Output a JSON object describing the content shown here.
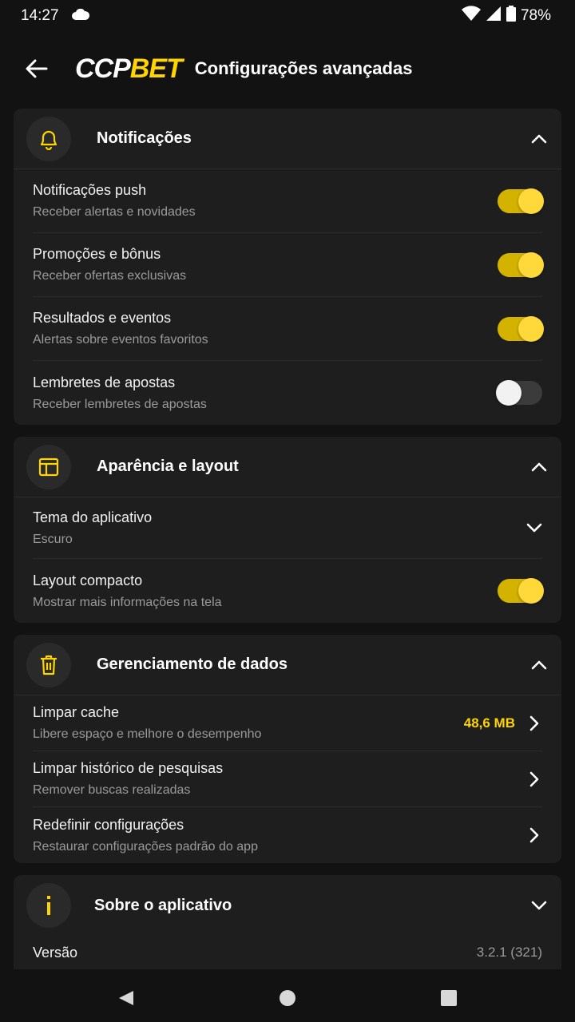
{
  "status_bar": {
    "time": "14:27",
    "battery": "78%",
    "icons": [
      "cloud-icon",
      "wifi-icon",
      "signal-icon",
      "battery-icon"
    ]
  },
  "header": {
    "back_icon": "arrow-left-icon",
    "logo_part1": "CCP",
    "logo_part2": "BET",
    "title": "Configurações avançadas"
  },
  "colors": {
    "accent": "#ffd400",
    "background": "#121212",
    "card": "#1e1e1e"
  },
  "notifications": {
    "title": "Notificações",
    "icon": "bell-icon",
    "items": [
      {
        "label": "Notificações push",
        "sub": "Receber alertas e novidades",
        "enabled": true
      },
      {
        "label": "Promoções e bônus",
        "sub": "Receber ofertas exclusivas",
        "enabled": true
      },
      {
        "label": "Resultados e eventos",
        "sub": "Alertas sobre eventos favoritos",
        "enabled": true
      },
      {
        "label": "Lembretes de apostas",
        "sub": "Receber lembretes de apostas",
        "enabled": false
      }
    ]
  },
  "appearance": {
    "title": "Aparência e layout",
    "icon": "layout-icon",
    "theme": {
      "label": "Tema do aplicativo",
      "value": "Escuro"
    },
    "compact": {
      "label": "Layout compacto",
      "sub": "Mostrar mais informações na tela",
      "enabled": true
    }
  },
  "data_management": {
    "title": "Gerenciamento de dados",
    "icon": "trash-icon",
    "cache": {
      "label": "Limpar cache",
      "sub": "Libere espaço e melhore o desempenho",
      "size": "48,6 MB"
    },
    "history": {
      "label": "Limpar histórico de pesquisas",
      "sub": "Remover buscas realizadas"
    },
    "reset": {
      "label": "Redefinir configurações",
      "sub": "Restaurar configurações padrão do app"
    }
  },
  "about": {
    "title": "Sobre o aplicativo",
    "icon": "info-icon",
    "version_label": "Versão",
    "version_value": "3.2.1 (321)"
  },
  "nav": {
    "back": "triangle-back-icon",
    "home": "circle-home-icon",
    "recents": "square-recents-icon"
  }
}
